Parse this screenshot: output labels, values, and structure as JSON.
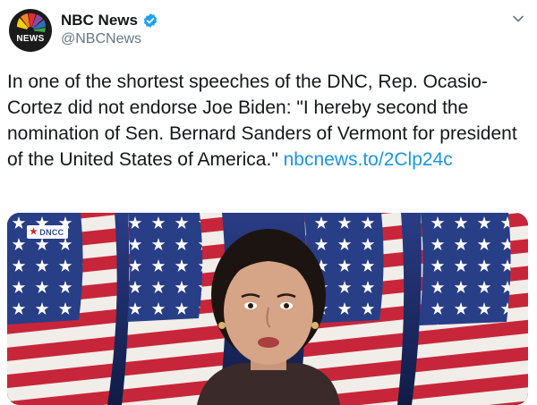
{
  "account": {
    "display_name": "NBC News",
    "handle": "@NBCNews",
    "avatar_label": "NEWS",
    "verified": true
  },
  "tweet": {
    "text": "In one of the shortest speeches of the DNC, Rep. Ocasio-Cortez did not endorse Joe Biden: \"I hereby second the nomination of Sen. Bernard Sanders of Vermont for president of the United States of America.\" ",
    "link": "nbcnews.to/2Clp24c"
  },
  "media": {
    "badge_label": "DNCC"
  },
  "icons": {
    "avatar": "peacock-logo-icon",
    "verified": "verified-badge-icon",
    "menu": "chevron-down-icon"
  },
  "colors": {
    "link": "#1b95e0",
    "verified": "#1da1f2",
    "text": "#14171a",
    "secondary": "#657786"
  }
}
